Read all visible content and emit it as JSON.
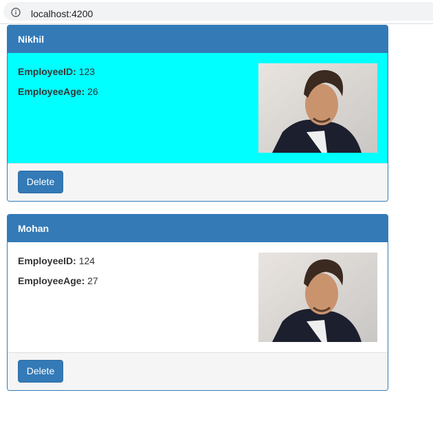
{
  "browser": {
    "url": "localhost:4200",
    "icon": "info-icon"
  },
  "colors": {
    "primary": "#337ab7",
    "highlight": "#00ffff",
    "footer": "#f5f5f5"
  },
  "employees": [
    {
      "name": "Nikhil",
      "id_label": "EmployeeID:",
      "id": "123",
      "age_label": "EmployeeAge:",
      "age": "26",
      "highlighted": true,
      "delete_label": "Delete"
    },
    {
      "name": "Mohan",
      "id_label": "EmployeeID:",
      "id": "124",
      "age_label": "EmployeeAge:",
      "age": "27",
      "highlighted": false,
      "delete_label": "Delete"
    }
  ]
}
